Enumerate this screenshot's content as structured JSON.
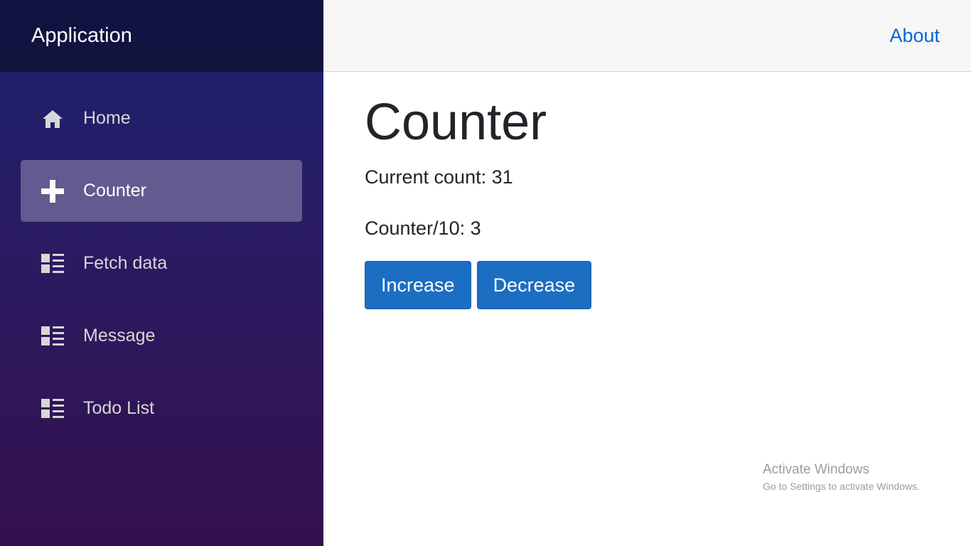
{
  "app": {
    "brand": "Application"
  },
  "sidebar": {
    "items": [
      {
        "label": "Home",
        "icon": "home-icon",
        "active": false
      },
      {
        "label": "Counter",
        "icon": "plus-icon",
        "active": true
      },
      {
        "label": "Fetch data",
        "icon": "list-icon",
        "active": false
      },
      {
        "label": "Message",
        "icon": "list-icon",
        "active": false
      },
      {
        "label": "Todo List",
        "icon": "list-icon",
        "active": false
      }
    ]
  },
  "header": {
    "about_label": "About"
  },
  "main": {
    "title": "Counter",
    "current_count_label": "Current count: 31",
    "counter_div_label": "Counter/10: 3",
    "increase_label": "Increase",
    "decrease_label": "Decrease"
  },
  "watermark": {
    "title": "Activate Windows",
    "subtitle": "Go to Settings to activate Windows."
  },
  "colors": {
    "primary": "#1b6ec2",
    "link": "#0366d6",
    "sidebar_top": "#1c2270",
    "sidebar_bottom": "#35104e"
  }
}
